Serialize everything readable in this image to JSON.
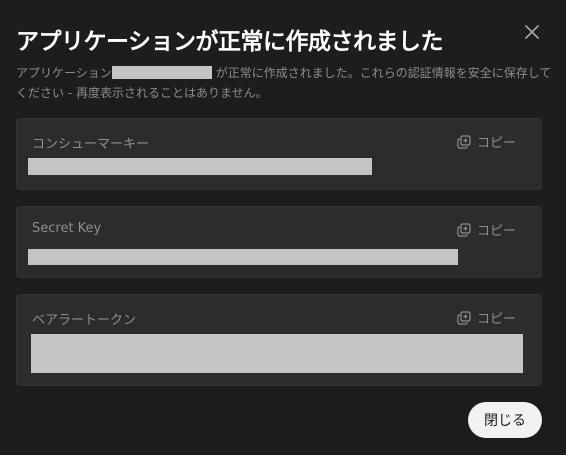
{
  "dialog": {
    "title": "アプリケーションが正常に作成されました",
    "description_prefix": "アプリケーション",
    "description_suffix": "が正常に作成されました。これらの認証情報を安全に保存してください - 再度表示されることはありません。"
  },
  "fields": [
    {
      "label": "コンシューマーキー",
      "copy_label": "コピー"
    },
    {
      "label": "Secret Key",
      "copy_label": "コピー"
    },
    {
      "label": "ベアラートークン",
      "copy_label": "コピー"
    }
  ],
  "footer": {
    "close_label": "閉じる"
  },
  "icons": {
    "close": "close-icon",
    "copy": "copy-icon"
  },
  "colors": {
    "background": "#1d1d1d",
    "field_background": "#2c2c2c",
    "redaction": "#c4c4c4",
    "button_background": "#f2f2f2"
  }
}
